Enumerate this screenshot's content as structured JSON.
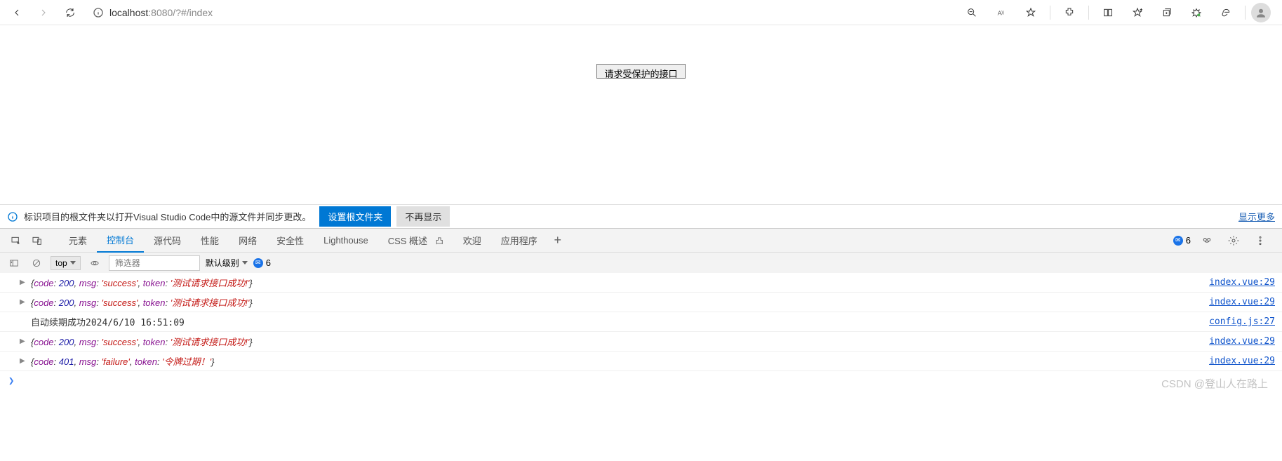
{
  "browser": {
    "url_host": "localhost",
    "url_rest": ":8080/?#/index"
  },
  "page": {
    "button_label": "请求受保护的接口"
  },
  "infobar": {
    "text": "标识项目的根文件夹以打开Visual Studio Code中的源文件并同步更改。",
    "primary_btn": "设置根文件夹",
    "secondary_btn": "不再显示",
    "show_more": "显示更多"
  },
  "devtools": {
    "tabs": {
      "elements": "元素",
      "console": "控制台",
      "sources": "源代码",
      "performance": "性能",
      "network": "网络",
      "security": "安全性",
      "lighthouse": "Lighthouse",
      "css_overview": "CSS 概述",
      "welcome": "欢迎",
      "application": "应用程序"
    },
    "error_count": "6",
    "beta_mark": "凸"
  },
  "console_toolbar": {
    "context": "top",
    "filter_placeholder": "筛选器",
    "level": "默认级别",
    "msg_count": "6"
  },
  "console": {
    "rows": [
      {
        "type": "obj",
        "code": "200",
        "msg": "'success'",
        "token": "'测试请求接口成功!'",
        "source": "index.vue:29"
      },
      {
        "type": "obj",
        "code": "200",
        "msg": "'success'",
        "token": "'测试请求接口成功!'",
        "source": "index.vue:29"
      },
      {
        "type": "plain",
        "text": "自动续期成功2024/6/10 16:51:09",
        "source": "config.js:27"
      },
      {
        "type": "obj",
        "code": "200",
        "msg": "'success'",
        "token": "'测试请求接口成功!'",
        "source": "index.vue:29"
      },
      {
        "type": "obj",
        "code": "401",
        "msg": "'failure'",
        "token": "'令牌过期！'",
        "source": "index.vue:29"
      }
    ],
    "prompt": "❯"
  },
  "watermark": "CSDN @登山人在路上"
}
